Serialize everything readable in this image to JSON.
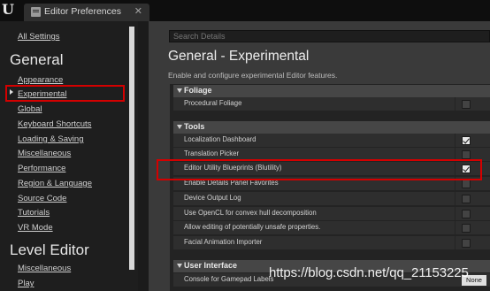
{
  "window": {
    "tab_title": "Editor Preferences",
    "close_glyph": "✕"
  },
  "sidebar": {
    "all_settings": "All Settings",
    "general_heading": "General",
    "general_items": [
      "Appearance",
      "Experimental",
      "Global",
      "Keyboard Shortcuts",
      "Loading & Saving",
      "Miscellaneous",
      "Performance",
      "Region & Language",
      "Source Code",
      "Tutorials",
      "VR Mode"
    ],
    "selected_item": "Experimental",
    "level_editor_heading": "Level Editor",
    "level_editor_items": [
      "Miscellaneous",
      "Play"
    ]
  },
  "search": {
    "placeholder": "Search Details"
  },
  "main": {
    "title": "General - Experimental",
    "description": "Enable and configure experimental Editor features."
  },
  "sections": [
    {
      "label": "Foliage",
      "rows": [
        {
          "label": "Procedural Foliage",
          "checked": false
        }
      ]
    },
    {
      "label": "Tools",
      "rows": [
        {
          "label": "Localization Dashboard",
          "checked": true
        },
        {
          "label": "Translation Picker",
          "checked": false
        },
        {
          "label": "Editor Utility Blueprints (Blutility)",
          "checked": true
        },
        {
          "label": "Enable Details Panel Favorites",
          "checked": false
        },
        {
          "label": "Device Output Log",
          "checked": false
        },
        {
          "label": "Use OpenCL for convex hull decomposition",
          "checked": false
        },
        {
          "label": "Allow editing of potentially unsafe properties.",
          "checked": false
        },
        {
          "label": "Facial Animation Importer",
          "checked": false
        }
      ]
    },
    {
      "label": "User Interface",
      "rows": [
        {
          "label": "Console for Gamepad Labels",
          "value": "None"
        }
      ]
    }
  ],
  "watermark": "https://blog.csdn.net/qq_21153225",
  "colors": {
    "highlight_red": "#d40000",
    "panel_bg": "#3a3a3a",
    "sidebar_bg": "#1e1e1e"
  }
}
